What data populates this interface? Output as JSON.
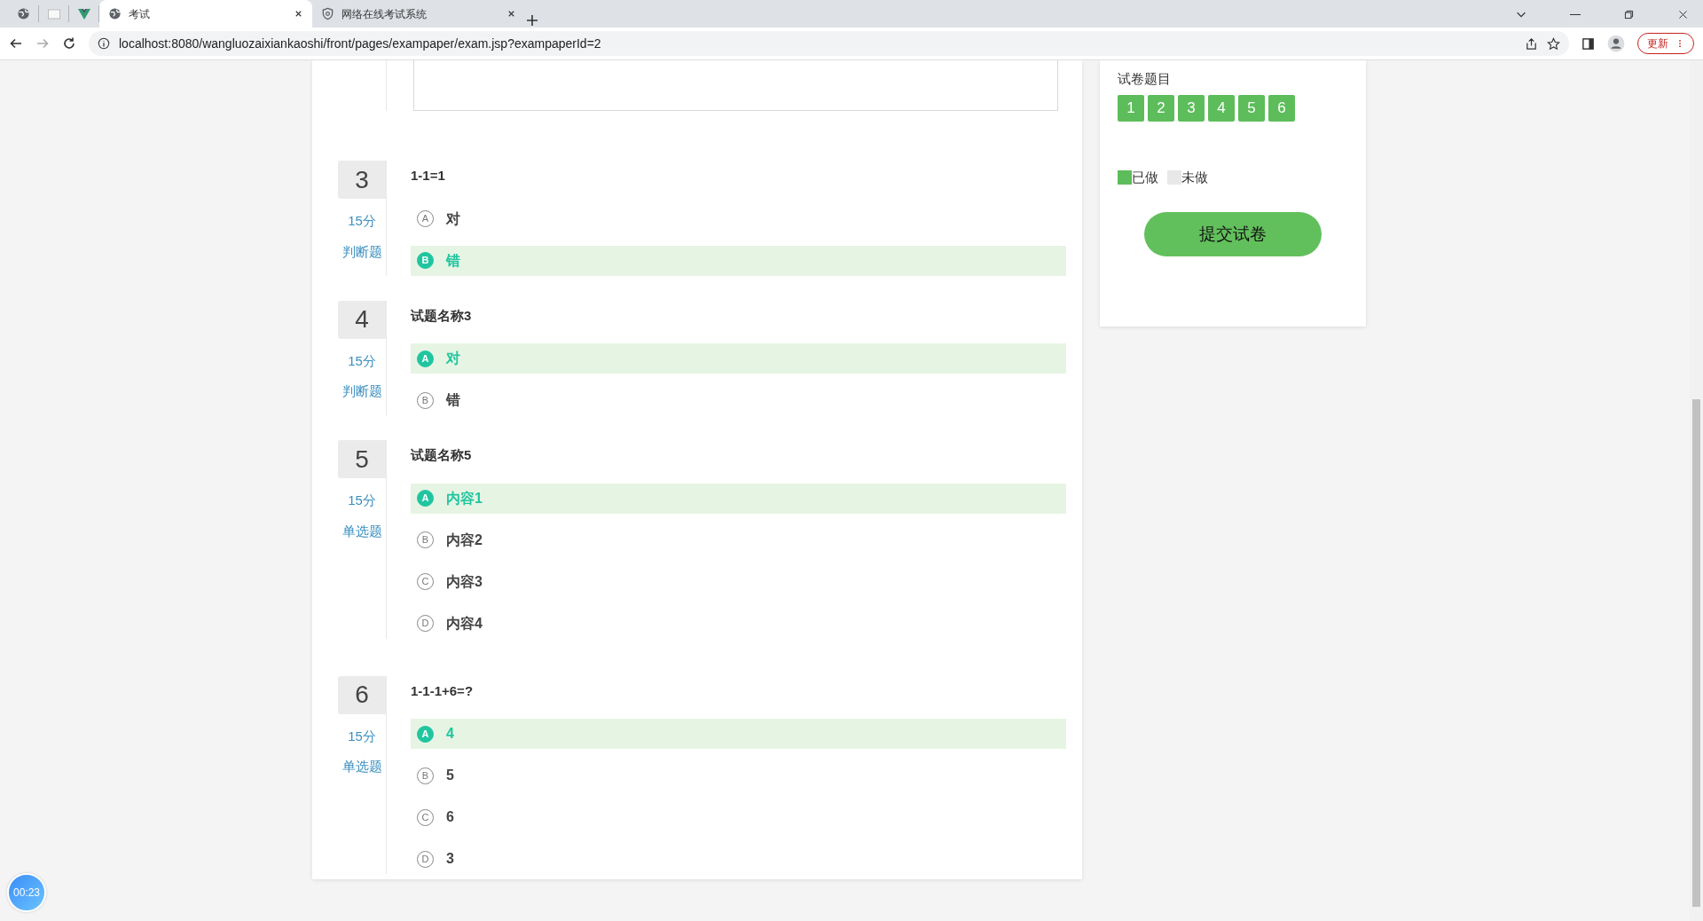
{
  "browser": {
    "pinned_tabs": [
      {
        "kind": "globe"
      },
      {
        "kind": "blank"
      },
      {
        "kind": "vue"
      }
    ],
    "tabs": [
      {
        "title": "考试",
        "selected": true,
        "kind": "globe"
      },
      {
        "title": "网络在线考试系统",
        "selected": false,
        "kind": "shield"
      }
    ],
    "url": "localhost:8080/wangluozaixiankaoshi/front/pages/exampaper/exam.jsp?exampaperId=2",
    "update_button": "更新"
  },
  "questions": [
    {
      "number": "3",
      "title": "1-1=1",
      "score": "15分",
      "type": "判断题",
      "options": [
        {
          "letter": "A",
          "text": "对",
          "selected": false
        },
        {
          "letter": "B",
          "text": "错",
          "selected": true
        }
      ]
    },
    {
      "number": "4",
      "title": "试题名称3",
      "score": "15分",
      "type": "判断题",
      "options": [
        {
          "letter": "A",
          "text": "对",
          "selected": true
        },
        {
          "letter": "B",
          "text": "错",
          "selected": false
        }
      ]
    },
    {
      "number": "5",
      "title": "试题名称5",
      "score": "15分",
      "type": "单选题",
      "options": [
        {
          "letter": "A",
          "text": "内容1",
          "selected": true
        },
        {
          "letter": "B",
          "text": "内容2",
          "selected": false
        },
        {
          "letter": "C",
          "text": "内容3",
          "selected": false
        },
        {
          "letter": "D",
          "text": "内容4",
          "selected": false
        }
      ]
    },
    {
      "number": "6",
      "title": "1-1-1+6=?",
      "score": "15分",
      "type": "单选题",
      "options": [
        {
          "letter": "A",
          "text": "4",
          "selected": true
        },
        {
          "letter": "B",
          "text": "5",
          "selected": false
        },
        {
          "letter": "C",
          "text": "6",
          "selected": false
        },
        {
          "letter": "D",
          "text": "3",
          "selected": false
        }
      ]
    }
  ],
  "sidebar": {
    "title": "试卷题目",
    "question_buttons": [
      {
        "label": "1",
        "done": true
      },
      {
        "label": "2",
        "done": true
      },
      {
        "label": "3",
        "done": true
      },
      {
        "label": "4",
        "done": true
      },
      {
        "label": "5",
        "done": true
      },
      {
        "label": "6",
        "done": true
      }
    ],
    "legend": [
      {
        "label": "已做",
        "kind": "done"
      },
      {
        "label": "未做",
        "kind": "undone"
      }
    ],
    "submit_button": "提交试卷"
  },
  "timer": "00:23"
}
